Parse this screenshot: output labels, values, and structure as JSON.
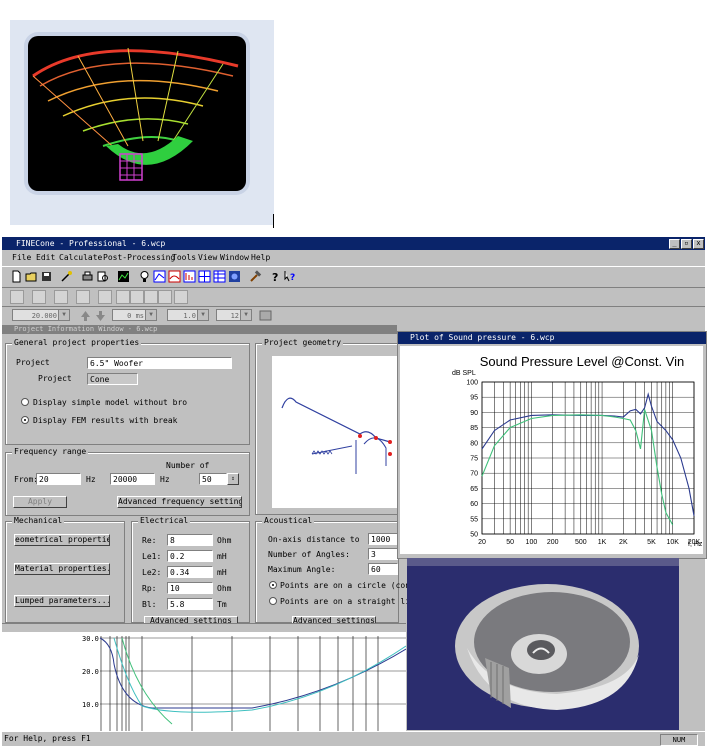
{
  "app": {
    "title": "FINECone - Professional - 6.wcp"
  },
  "menu": [
    "File",
    "Edit",
    "Calculate",
    "Post-Processing",
    "Tools",
    "View",
    "Window",
    "Help"
  ],
  "toolbar3": {
    "combo1": "20.000",
    "combo2": "0 ms",
    "combo3": "1.0",
    "combo4": "12"
  },
  "project_window": {
    "title": "Project Information Window - 6.wcp",
    "general": {
      "label": "General project properties",
      "project_label": "Project",
      "project_value": "6.5\" Woofer",
      "project_type_label": "Project",
      "project_type_value": "Cone",
      "radio_simple": "Display simple model without bro",
      "radio_fem": "Display FEM results with break"
    },
    "geometry": {
      "label": "Project geometry"
    },
    "frequency": {
      "label": "Frequency range",
      "number_of_label": "Number of",
      "from_label": "From:",
      "from_value": "20",
      "from_unit": "Hz",
      "to_value": "20000",
      "to_unit": "Hz",
      "number_value": "50",
      "apply_button": "Apply",
      "advanced_button": "Advanced frequency settings..."
    },
    "mechanical": {
      "label": "Mechanical",
      "geometrical_button": "eometrical properties...",
      "material_button": "Material properties...",
      "lumped_button": "Lumped parameters..."
    },
    "electrical": {
      "label": "Electrical",
      "rows": [
        {
          "name": "Re:",
          "value": "8",
          "unit": "Ohm"
        },
        {
          "name": "Le1:",
          "value": "0.2",
          "unit": "mH"
        },
        {
          "name": "Le2:",
          "value": "0.34",
          "unit": "mH"
        },
        {
          "name": "Rp:",
          "value": "10",
          "unit": "Ohm"
        },
        {
          "name": "Bl:",
          "value": "5.8",
          "unit": "Tm"
        }
      ],
      "advanced_button": "Advanced settings"
    },
    "acoustical": {
      "label": "Acoustical",
      "rows": [
        {
          "name": "On-axis distance to",
          "value": "1000"
        },
        {
          "name": "Number of Angles:",
          "value": "3"
        },
        {
          "name": "Maximum Angle:",
          "value": "60"
        }
      ],
      "radio_circle": "Points are on a circle (constan",
      "radio_line": "Points are on a straight line",
      "advanced_button": "Advanced settings"
    }
  },
  "plot_window": {
    "title": "Plot of Sound pressure - 6.wcp",
    "chart_title": "Sound Pressure Level @Const. Vin",
    "chart_data": {
      "type": "line",
      "title": "Sound Pressure Level @Const. Vin",
      "ylabel": "dB SPL",
      "xlabel": "f, Hz",
      "xscale": "log",
      "xlim": [
        20,
        20000
      ],
      "ylim": [
        50,
        100
      ],
      "y_ticks": [
        50,
        55,
        60,
        65,
        70,
        75,
        80,
        85,
        90,
        95,
        100
      ],
      "x_ticks": [
        {
          "v": 20,
          "label": "20"
        },
        {
          "v": 50,
          "label": "50"
        },
        {
          "v": 100,
          "label": "100"
        },
        {
          "v": 200,
          "label": "200"
        },
        {
          "v": 500,
          "label": "500"
        },
        {
          "v": 1000,
          "label": "1K"
        },
        {
          "v": 2000,
          "label": "2K"
        },
        {
          "v": 5000,
          "label": "5K"
        },
        {
          "v": 10000,
          "label": "10K"
        },
        {
          "v": 20000,
          "label": "20K"
        }
      ],
      "grid": true,
      "series": [
        {
          "color": "#2b3a8f",
          "x": [
            20,
            30,
            50,
            100,
            200,
            500,
            1000,
            1500,
            2000,
            2500,
            3000,
            3500,
            4000,
            4500,
            5000,
            6000,
            8000,
            10000,
            13000,
            17000,
            20000
          ],
          "y": [
            78,
            84,
            87.5,
            89,
            89.2,
            89,
            89,
            88.8,
            88.5,
            90.5,
            91,
            89.5,
            91.5,
            96,
            92,
            87,
            84,
            81,
            75,
            65,
            56
          ]
        },
        {
          "color": "#3fc07a",
          "x": [
            20,
            30,
            50,
            100,
            200,
            500,
            1000,
            1500,
            2000,
            2500,
            3000,
            3500,
            4000,
            5000,
            6000,
            7000,
            8000,
            10000
          ],
          "y": [
            69,
            79,
            85,
            88,
            89,
            89.2,
            89,
            88.5,
            88,
            87.5,
            84,
            78,
            91,
            84,
            72,
            63,
            57,
            53
          ]
        }
      ]
    }
  },
  "bottom_plot": {
    "y_labels": [
      "30.0",
      "20.0",
      "10.0"
    ]
  },
  "status": {
    "help": "For Help, press F1",
    "cell": "NUM"
  },
  "colors": {
    "titlebar": "#0a246a",
    "window": "#c0c0c0",
    "view3d": "#2b2d6e"
  }
}
